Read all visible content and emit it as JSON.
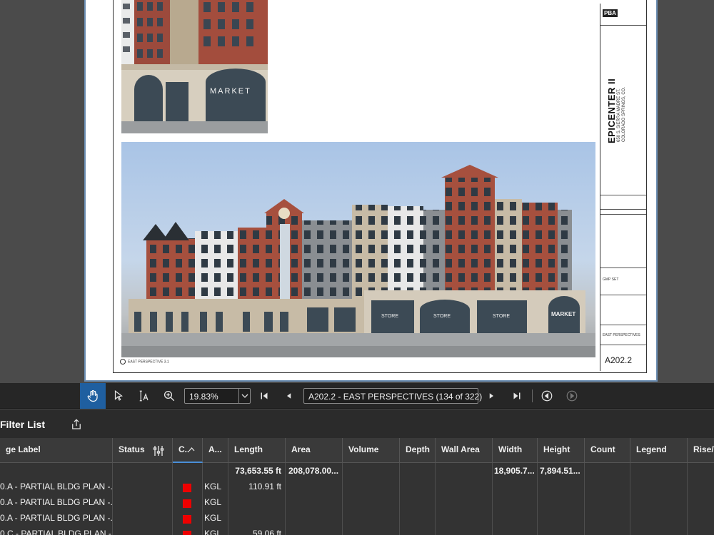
{
  "document": {
    "render_top_sign": "MARKET",
    "render_main_signs": [
      "STORE",
      "STORE",
      "STORE",
      "MARKET"
    ],
    "title_block": {
      "logo_text": "PBA",
      "project_name": "EPICENTER II",
      "address_line1": "650 S. SIERRA MADRE ST.",
      "address_line2": "COLORADO SPRINGS, CO.",
      "set_label": "GMP SET",
      "sheet_title": "EAST PERSPECTIVES",
      "sheet_number": "A202.2"
    },
    "caption": "EAST PERSPECTIVE 3.1"
  },
  "toolbar": {
    "zoom_value": "19.83%",
    "page_indicator": "A202.2 - EAST PERSPECTIVES (134 of 322)"
  },
  "filter_panel": {
    "title": "Filter List"
  },
  "table": {
    "columns": [
      "ge Label",
      "Status",
      "C..",
      "A...",
      "Length",
      "Area",
      "Volume",
      "Depth",
      "Wall Area",
      "Width",
      "Height",
      "Count",
      "Legend",
      "Rise/R"
    ],
    "totals": {
      "length": "73,653.55 ft",
      "area": "208,078.00...",
      "width": "18,905.7...",
      "height": "7,894.51..."
    },
    "rows": [
      {
        "label": "0.A - PARTIAL BLDG PLAN -...",
        "color": "#ee0000",
        "author": "KGL",
        "length": "110.91 ft"
      },
      {
        "label": "0.A - PARTIAL BLDG PLAN -...",
        "color": "#ee0000",
        "author": "KGL",
        "length": ""
      },
      {
        "label": "0.A - PARTIAL BLDG PLAN -...",
        "color": "#ee0000",
        "author": "KGL",
        "length": ""
      },
      {
        "label": "0.C - PARTIAL BLDG PLAN -...",
        "color": "#ee0000",
        "author": "KGL",
        "length": "59.06 ft"
      }
    ]
  }
}
